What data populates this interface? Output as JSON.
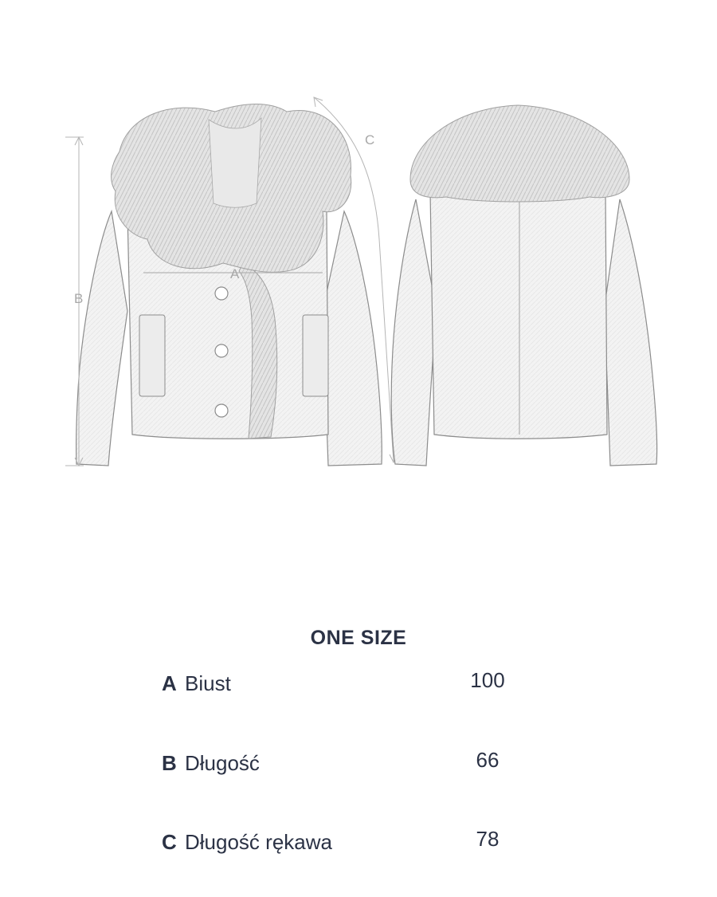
{
  "illustration": {
    "front_labels": {
      "a": "A",
      "b": "B",
      "c": "C"
    },
    "colors": {
      "outline": "#8c8c8c",
      "fur": "#d6d6d6",
      "fabric": "#f2f2f2",
      "dim_line": "#b5b5b5"
    }
  },
  "size_table": {
    "title": "ONE SIZE",
    "rows": [
      {
        "letter": "A",
        "name": "Biust",
        "value": "100"
      },
      {
        "letter": "B",
        "name": "Długość",
        "value": "66"
      },
      {
        "letter": "C",
        "name": "Długość rękawa",
        "value": "78"
      }
    ]
  },
  "colors": {
    "text": "#2b3245",
    "background": "#ffffff"
  }
}
